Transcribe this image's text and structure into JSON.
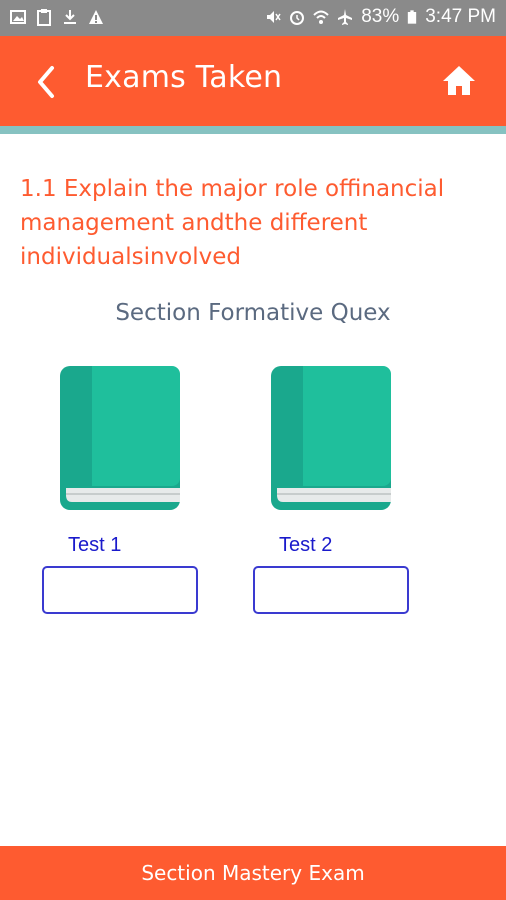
{
  "status_bar": {
    "battery": "83%",
    "time": "3:47 PM",
    "left_icons": [
      "image-icon",
      "clipboard-icon",
      "download-icon",
      "warning-icon"
    ],
    "right_icons": [
      "mute-icon",
      "alarm-icon",
      "wifi-icon",
      "airplane-icon",
      "battery-icon"
    ]
  },
  "header": {
    "title": "Exams Taken",
    "back_icon": "chevron-left-icon",
    "home_icon": "home-icon",
    "color": "#fe5b30",
    "accent_color": "#86c2c1"
  },
  "question": "1.1 Explain the major role offinancial management andthe different individualsinvolved",
  "section_label": "Section Formative Quex",
  "tests": [
    {
      "label": "Test  1",
      "score": ""
    },
    {
      "label": "Test  2",
      "score": ""
    }
  ],
  "footer": {
    "label": "Section Mastery Exam"
  }
}
